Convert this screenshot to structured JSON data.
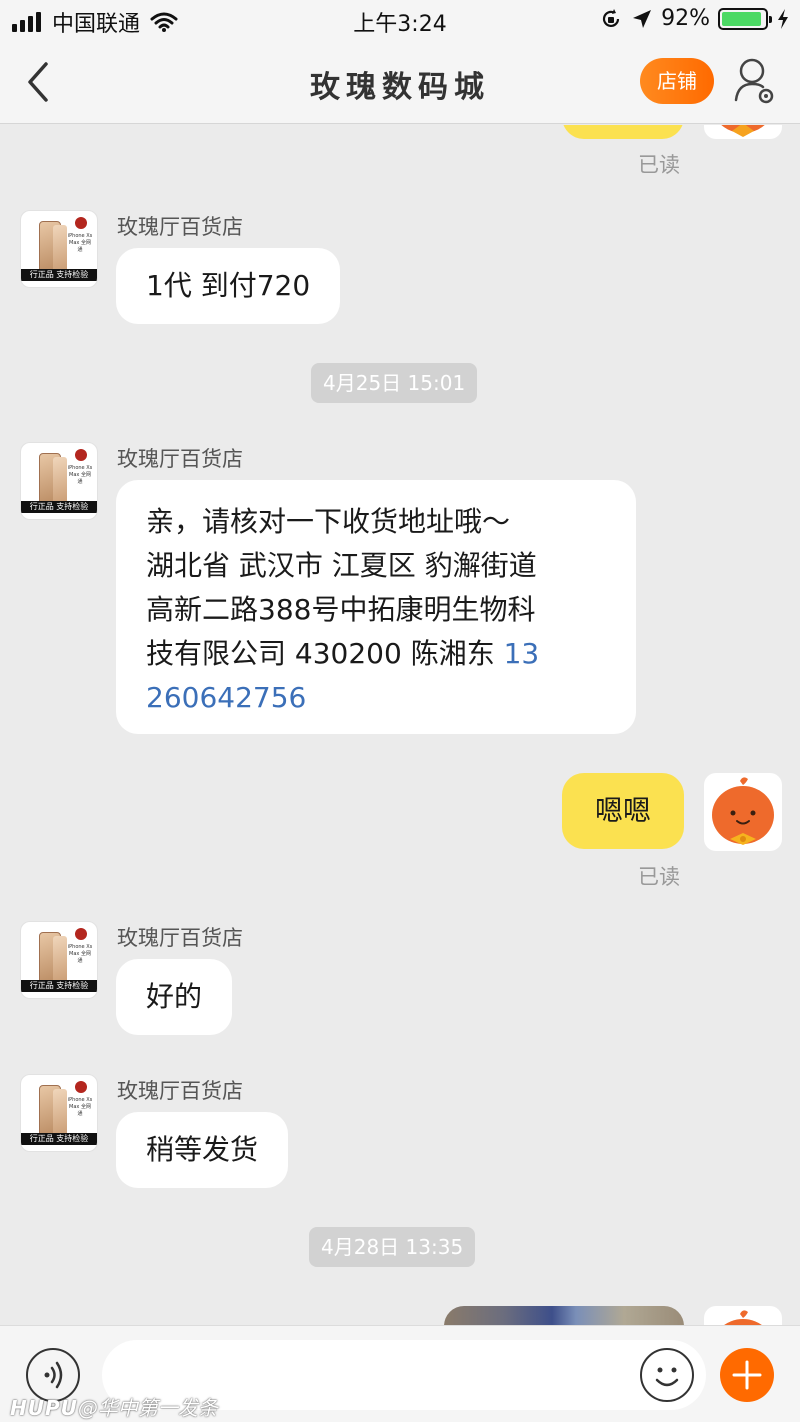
{
  "status_bar": {
    "carrier": "中国联通",
    "time": "上午3:24",
    "battery": "92%",
    "battery_level": 0.92
  },
  "nav": {
    "title": "玫瑰数码城",
    "shop_button": "店铺",
    "icons": [
      "back-icon",
      "user-settings-icon"
    ]
  },
  "shop_avatar": {
    "mini_text": "iPhone Xs Max 全网通",
    "banner": "行正品 支持检验"
  },
  "messages": [
    {
      "side": "right",
      "read": "已读"
    },
    {
      "side": "left",
      "sender": "玫瑰厅百货店",
      "text": "1代 到付720"
    },
    {
      "type": "time",
      "text": "4月25日 15:01"
    },
    {
      "side": "left",
      "sender": "玫瑰厅百货店",
      "lines": [
        "亲，请核对一下收货地址哦～",
        "湖北省  武汉市  江夏区  豹澥街道",
        "高新二路388号中拓康明生物科",
        "技有限公司  430200  陈湘东 "
      ],
      "phone_part1": "13",
      "phone_part2": "260642756"
    },
    {
      "side": "right",
      "text": "嗯嗯",
      "read": "已读"
    },
    {
      "side": "left",
      "sender": "玫瑰厅百货店",
      "text": "好的"
    },
    {
      "side": "left",
      "sender": "玫瑰厅百货店",
      "text": "稍等发货"
    },
    {
      "type": "time",
      "text": "4月28日 13:35"
    },
    {
      "side": "right",
      "kind": "image"
    }
  ],
  "input_bar": {
    "placeholder": "",
    "icons": [
      "voice-icon",
      "emoji-icon",
      "plus-icon"
    ]
  },
  "watermark": {
    "brand": "HUPU",
    "text": "@华中第一发条"
  },
  "colors": {
    "accent_orange": "#ff6a00",
    "my_bubble": "#fbe150",
    "link_blue": "#3b6fb8",
    "chat_bg": "#ebebeb"
  }
}
